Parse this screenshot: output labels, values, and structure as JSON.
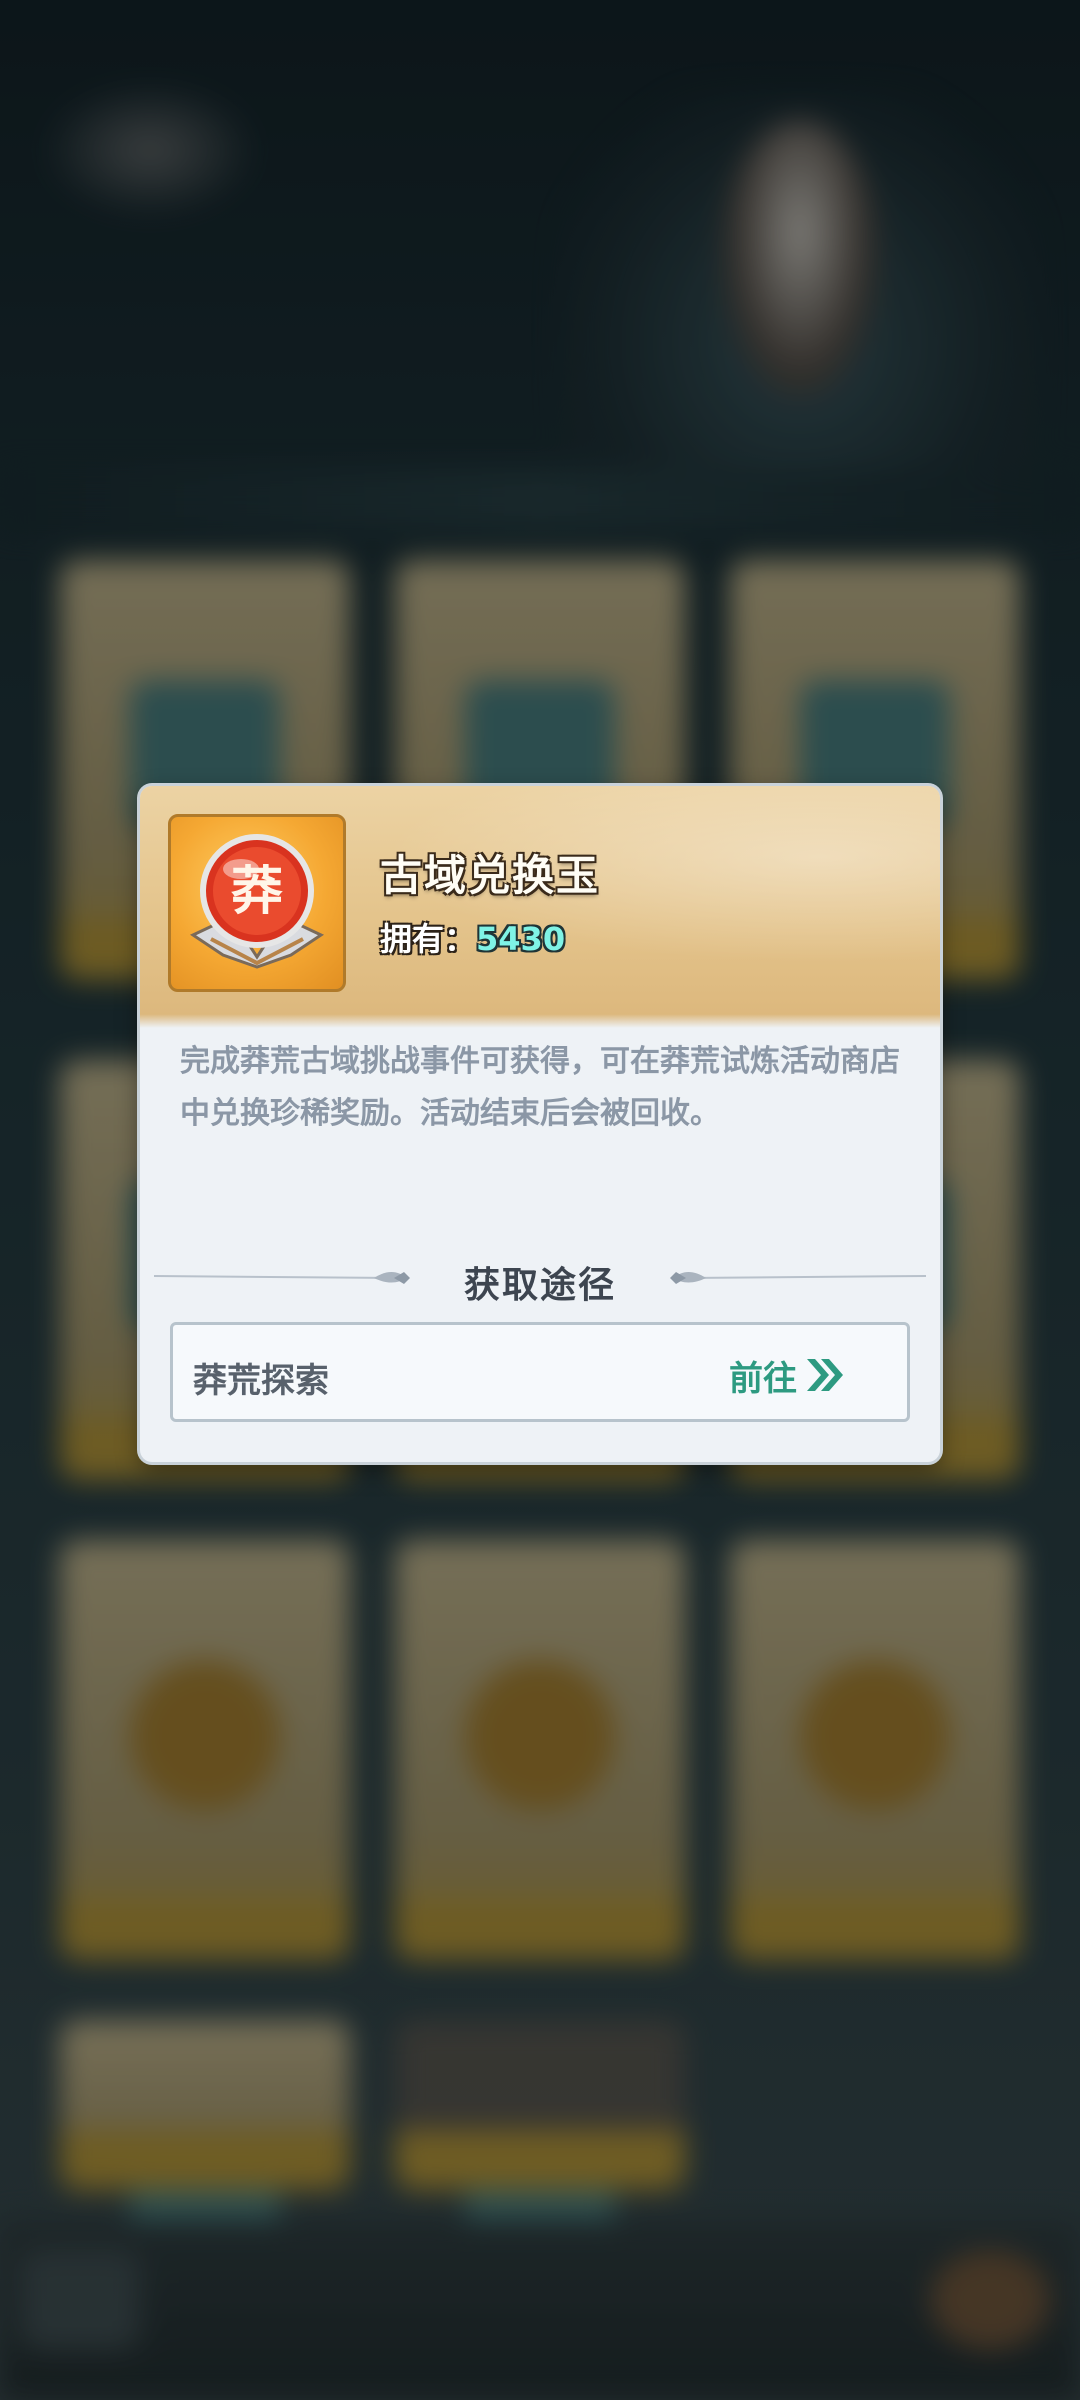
{
  "item": {
    "name": "古域兑换玉",
    "icon_glyph": "莽",
    "owned_label": "拥有：",
    "owned_value": "5430",
    "description": "完成莽荒古域挑战事件可获得，可在莽荒试炼活动商店中兑换珍稀奖励。活动结束后会被回收。"
  },
  "acquire": {
    "section_title": "获取途径",
    "sources": [
      {
        "name": "莽荒探索",
        "action_label": "前往",
        "action_icon": "double-chevron-right-icon"
      }
    ]
  },
  "colors": {
    "header_gold": "#e4c48c",
    "owned_value": "#7ff3e6",
    "go_green": "#2d9a81",
    "panel_bg": "#eef2f6"
  }
}
